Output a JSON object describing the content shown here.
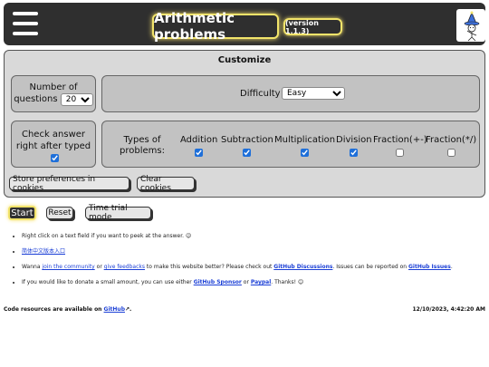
{
  "header": {
    "title": "Arithmetic problems",
    "version": "(version 1.1.3)"
  },
  "customize": {
    "title": "Customize",
    "question_count_label_1": "Number of",
    "question_count_label_2": "questions",
    "question_count_value": "20",
    "difficulty_label": "Difficulty",
    "difficulty_value": "Easy",
    "check_label_1": "Check answer",
    "check_label_2": "right after typed",
    "check_checked": true,
    "types_label_1": "Types of",
    "types_label_2": "problems:",
    "types": [
      {
        "label": "Addition",
        "checked": true
      },
      {
        "label": "Subtraction",
        "checked": true
      },
      {
        "label": "Multiplication",
        "checked": true
      },
      {
        "label": "Division",
        "checked": true
      },
      {
        "label": "Fraction(+-)",
        "checked": false
      },
      {
        "label": "Fraction(*/)",
        "checked": false
      }
    ],
    "store_label": "Store preferences in cookies",
    "clear_label": "Clear cookies"
  },
  "controls": {
    "start_label": "Start",
    "reset_label": "Reset",
    "trial_label": "Time trial mode"
  },
  "info": {
    "item1": "Right click on a text field if you want to peek at the answer. 😉",
    "item2_link": "简体中文版本入口",
    "item3_pre": "Wanna ",
    "item3_link1": "join the community",
    "item3_mid1": " or ",
    "item3_link2": "give feedbacks",
    "item3_mid2": " to make this website better? Please check out ",
    "item3_link3": "GitHub Discussions",
    "item3_mid3": ". Issues can be reported on ",
    "item3_link4": "GitHub Issues",
    "item3_end": ".",
    "item4_pre": "If you would like to donate a small amount, you can use either ",
    "item4_link1": "GitHub Sponsor",
    "item4_mid": " or ",
    "item4_link2": "Paypal",
    "item4_end": ". Thanks! 😊"
  },
  "footer": {
    "resources_pre": "Code resources are available on ",
    "resources_link": "GitHub",
    "resources_end": ".",
    "datetime": "12/10/2023, 4:42:20 AM"
  },
  "colors": {
    "header_bg": "#2f2f2f",
    "accent_glow": "#f2e46a",
    "panel_bg": "#d9d9d9",
    "link": "#1b3fd6"
  }
}
